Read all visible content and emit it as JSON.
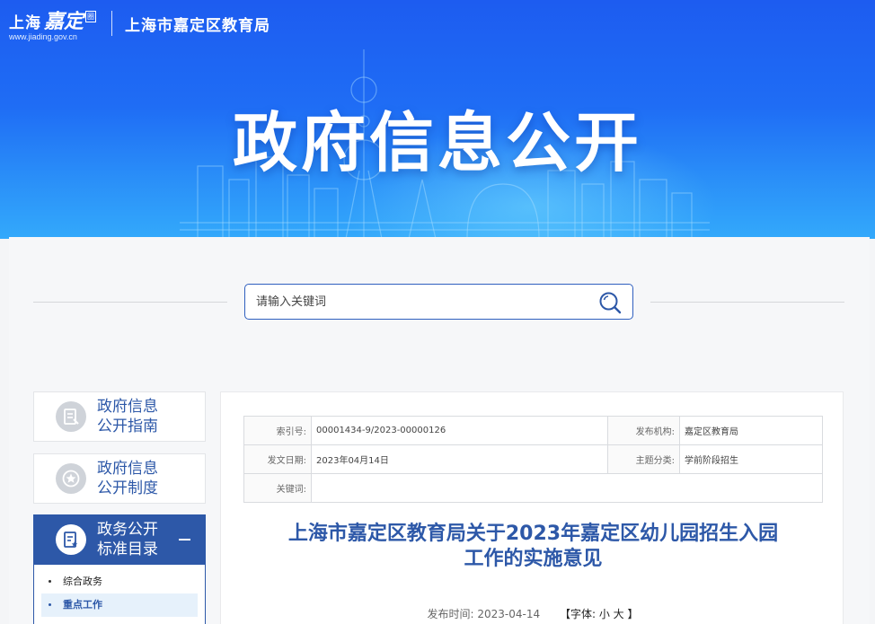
{
  "header": {
    "logo_shanghai": "上海",
    "logo_jiading": "嘉定",
    "logo_badge": "圈",
    "logo_url": "www.jiading.gov.cn",
    "bureau_name": "上海市嘉定区教育局",
    "banner_title": "政府信息公开"
  },
  "search": {
    "placeholder": "请输入关键词"
  },
  "sidebar": {
    "items": [
      {
        "line1": "政府信息",
        "line2": "公开指南"
      },
      {
        "line1": "政府信息",
        "line2": "公开制度"
      },
      {
        "line1": "政务公开",
        "line2": "标准目录"
      }
    ],
    "sub_items": [
      "综合政务",
      "重点工作"
    ]
  },
  "meta": {
    "index_label": "索引号:",
    "index_value": "00001434-9/2023-00000126",
    "publisher_label": "发布机构:",
    "publisher_value": "嘉定区教育局",
    "date_label": "发文日期:",
    "date_value": "2023年04月14日",
    "topic_label": "主题分类:",
    "topic_value": "学前阶段招生",
    "keyword_label": "关键词:",
    "keyword_value": ""
  },
  "document": {
    "title_line1": "上海市嘉定区教育局关于2023年嘉定区幼儿园招生入园",
    "title_line2": "工作的实施意见",
    "publish_label": "发布时间:",
    "publish_date": "2023-04-14",
    "font_label": "【字体:",
    "font_small": "小",
    "font_large": "大",
    "font_close": "】"
  },
  "colors": {
    "brand_blue": "#2d58a8",
    "banner_top": "#1d5cf0",
    "banner_bottom": "#33a9fb"
  }
}
